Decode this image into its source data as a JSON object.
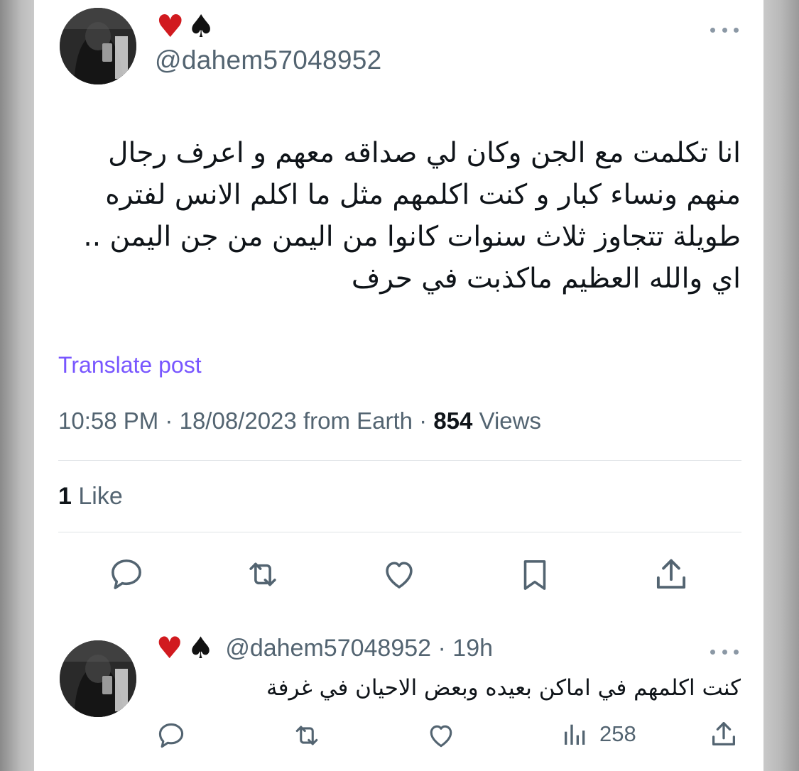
{
  "post": {
    "author_emojis": [
      "heart-emoji",
      "spade-emoji"
    ],
    "handle": "@dahem57048952",
    "text": "انا تكلمت مع الجن وكان لي صداقه معهم و اعرف رجال\nمنهم ونساء كبار و كنت اكلمهم مثل ما اكلم الانس لفتره\nطويلة تتجاوز ثلاث سنوات كانوا من اليمن من جن اليمن ..\nاي والله العظيم  ماكذبت في حرف",
    "translate_label": "Translate post",
    "time": "10:58 PM",
    "date": "18/08/2023",
    "source": "from Earth",
    "separator": "·",
    "views_count": "854",
    "views_label": "Views",
    "likes_count": "1",
    "likes_label": "Like"
  },
  "actions": [
    {
      "name": "reply",
      "icon": "reply-icon"
    },
    {
      "name": "repost",
      "icon": "repost-icon"
    },
    {
      "name": "like",
      "icon": "heart-icon"
    },
    {
      "name": "bookmark",
      "icon": "bookmark-icon"
    },
    {
      "name": "share",
      "icon": "share-icon"
    }
  ],
  "reply": {
    "handle": "@dahem57048952",
    "separator": "·",
    "age": "19h",
    "text": "كنت اكلمهم في اماكن بعيده وبعض الاحيان في غرفة",
    "views_count": "258"
  },
  "colors": {
    "text": "#0f1419",
    "secondary": "#536471",
    "translate": "#7856ff",
    "heart": "#d11a1f"
  }
}
